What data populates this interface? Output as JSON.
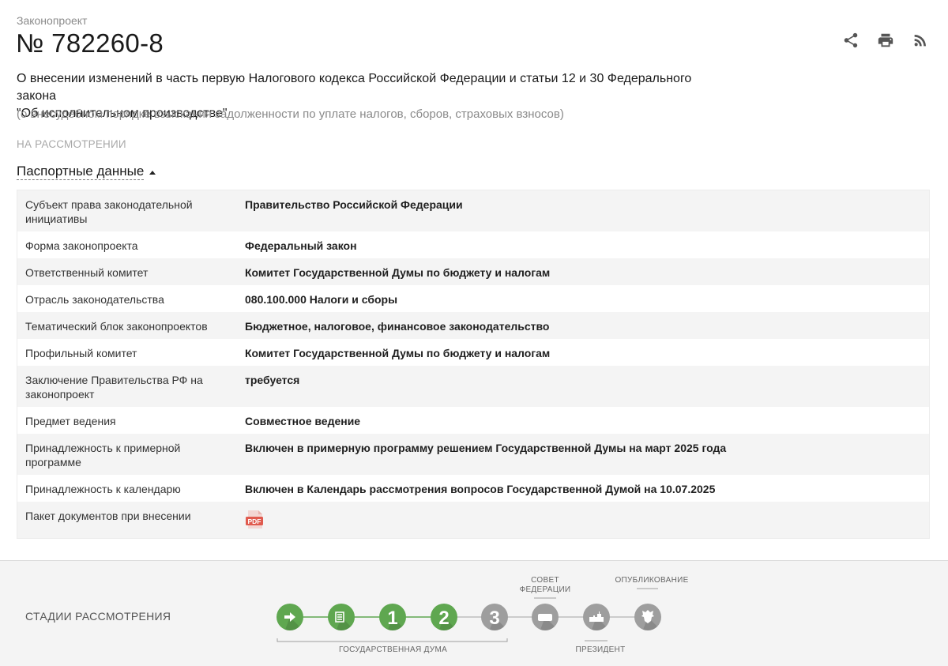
{
  "header": {
    "kicker": "Законопроект",
    "number": "№ 782260-8",
    "actions": [
      {
        "icon": "share-icon"
      },
      {
        "icon": "print-icon"
      },
      {
        "icon": "rss-icon"
      }
    ]
  },
  "bill": {
    "title_line1": "О внесении изменений в часть первую Налогового кодекса Российской Федерации и статьи 12 и 30 Федерального закона",
    "title_line2": "\"Об исполнительном производстве\"",
    "subtitle": "(о внесудебном порядке взыскания задолженности по уплате налогов, сборов, страховых взносов)",
    "status": "НА РАССМОТРЕНИИ"
  },
  "passport": {
    "toggle_label": "Паспортные данные",
    "rows": [
      {
        "key": "Субъект права законодательной инициативы",
        "value": "Правительство Российской Федерации"
      },
      {
        "key": "Форма законопроекта",
        "value": "Федеральный закон"
      },
      {
        "key": "Ответственный комитет",
        "value": "Комитет Государственной Думы по бюджету и налогам"
      },
      {
        "key": "Отрасль законодательства",
        "value": "080.100.000 Налоги и сборы"
      },
      {
        "key": "Тематический блок законопроектов",
        "value": "Бюджетное, налоговое, финансовое законодательство"
      },
      {
        "key": "Профильный комитет",
        "value": "Комитет Государственной Думы по бюджету и налогам"
      },
      {
        "key": "Заключение Правительства РФ на законопроект",
        "value": "требуется"
      },
      {
        "key": "Предмет ведения",
        "value": "Совместное ведение"
      },
      {
        "key": "Принадлежность к примерной программе",
        "value": "Включен в примерную программу решением Государственной Думы на март 2025 года"
      },
      {
        "key": "Принадлежность к календарю",
        "value": "Включен в Календарь рассмотрения вопросов Государственной Думой на 10.07.2025"
      },
      {
        "key": "Пакет документов при внесении",
        "value": "",
        "file": "PDF"
      }
    ]
  },
  "stages": {
    "label": "СТАДИИ РАССМОТРЕНИЯ",
    "group_duma": "ГОСУДАРСТВЕННАЯ ДУМА",
    "sovet_line1": "СОВЕТ",
    "sovet_line2": "ФЕДЕРАЦИИ",
    "president": "ПРЕЗИДЕНТ",
    "publication": "ОПУБЛИКОВАНИЕ",
    "steps": [
      {
        "icon": "arrow-right-icon",
        "text": "",
        "state": "done"
      },
      {
        "icon": "document-list-icon",
        "text": "",
        "state": "done"
      },
      {
        "icon": "",
        "text": "1",
        "state": "done"
      },
      {
        "icon": "",
        "text": "2",
        "state": "done"
      },
      {
        "icon": "",
        "text": "3",
        "state": "pending"
      },
      {
        "icon": "federation-council-icon",
        "text": "",
        "state": "pending"
      },
      {
        "icon": "president-building-icon",
        "text": "",
        "state": "pending"
      },
      {
        "icon": "coat-of-arms-icon",
        "text": "",
        "state": "pending"
      }
    ],
    "colors": {
      "done": "#5fa750",
      "pending": "#9e9e9e",
      "line_done": "#5fa750",
      "line_pending": "#bdbdbd"
    }
  }
}
